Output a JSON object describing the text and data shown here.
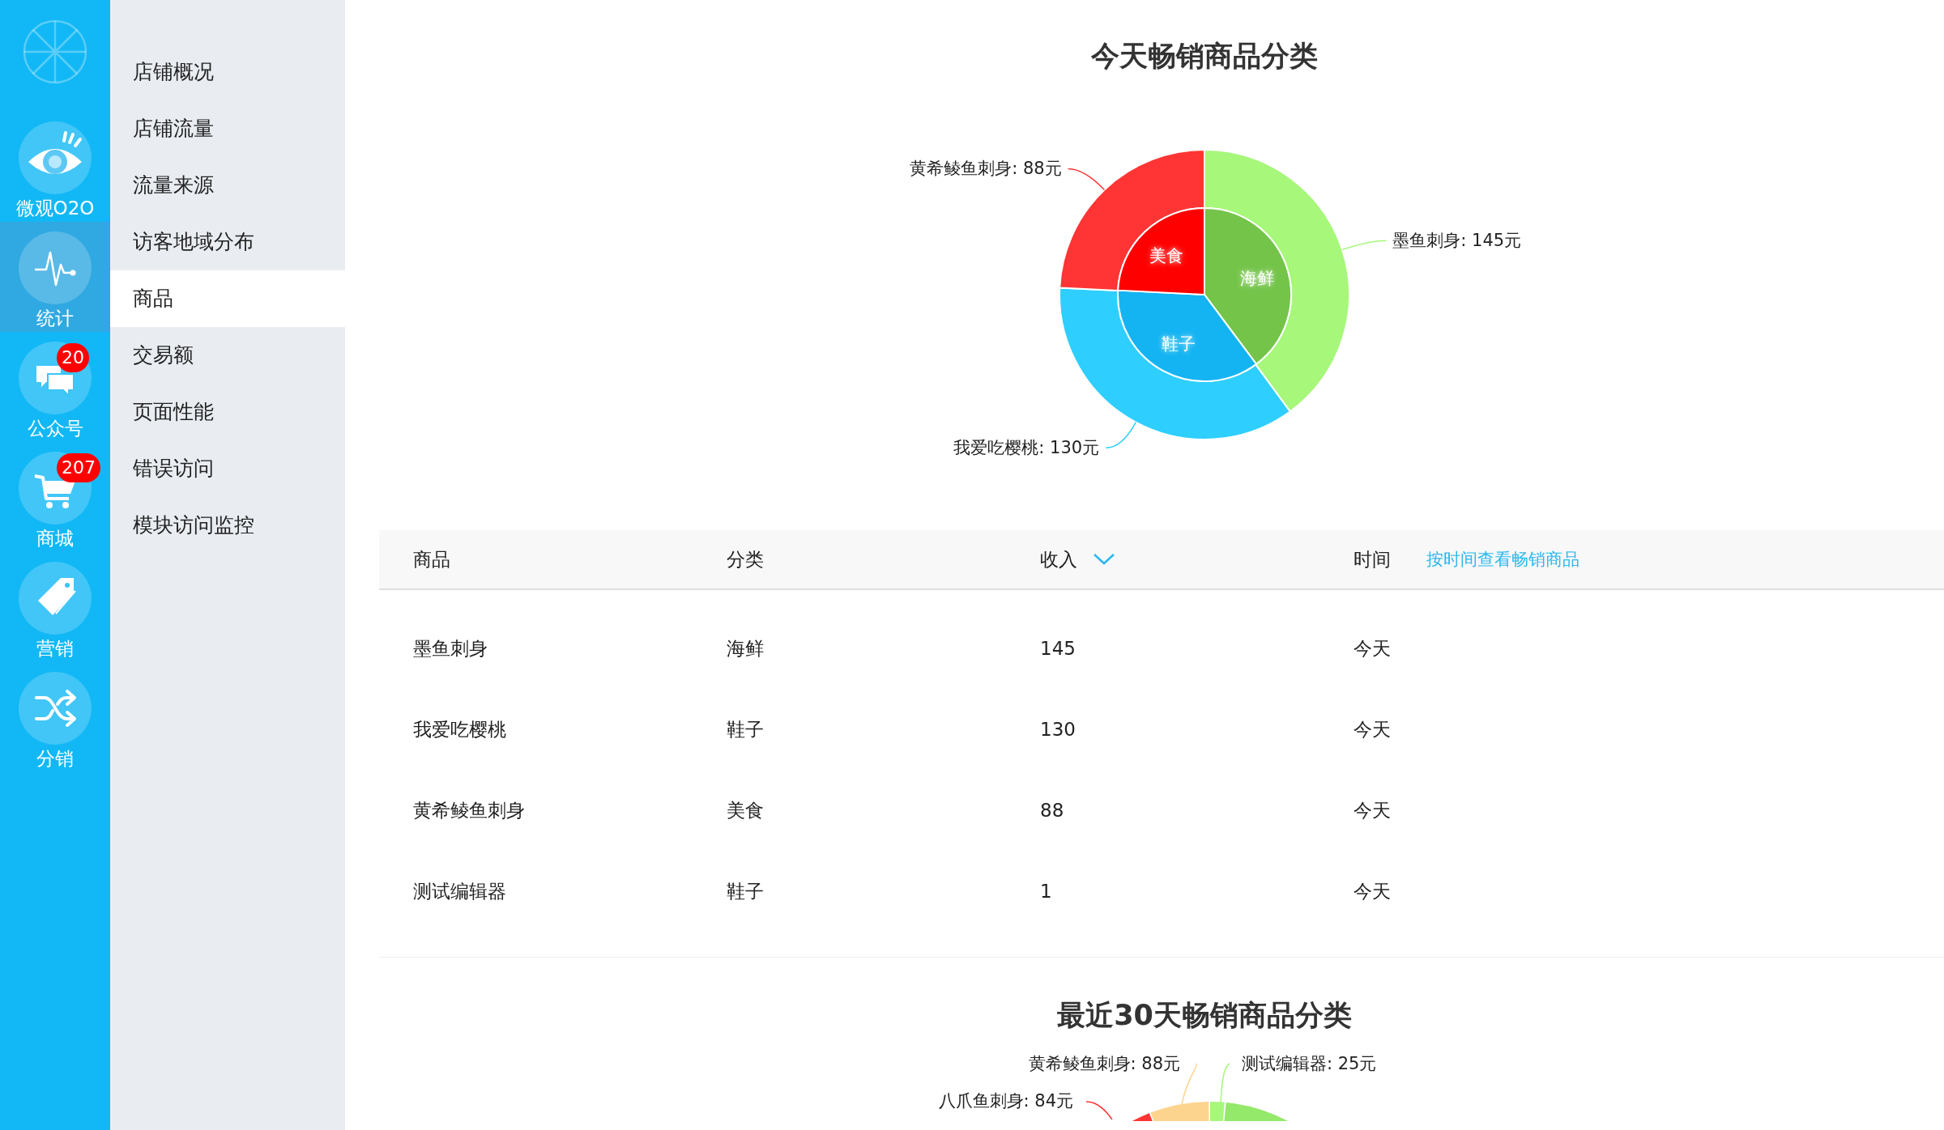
{
  "rail": {
    "items": [
      {
        "kind": "eye",
        "label": "微观O2O",
        "selected": false
      },
      {
        "kind": "pulse",
        "label": "统计",
        "selected": true
      },
      {
        "kind": "chat",
        "label": "公众号",
        "badge": "20",
        "selected": false
      },
      {
        "kind": "cart",
        "label": "商城",
        "badge": "207",
        "selected": false
      },
      {
        "kind": "tag",
        "label": "营销",
        "selected": false
      },
      {
        "kind": "shuffle",
        "label": "分销",
        "selected": false
      }
    ]
  },
  "submenu": {
    "items": [
      {
        "label": "店铺概况",
        "selected": false
      },
      {
        "label": "店铺流量",
        "selected": false
      },
      {
        "label": "流量来源",
        "selected": false
      },
      {
        "label": "访客地域分布",
        "selected": false
      },
      {
        "label": "商品",
        "selected": true
      },
      {
        "label": "交易额",
        "selected": false
      },
      {
        "label": "页面性能",
        "selected": false
      },
      {
        "label": "错误访问",
        "selected": false
      },
      {
        "label": "模块访问监控",
        "selected": false
      }
    ]
  },
  "today_chart": {
    "title": "今天畅销商品分类",
    "inner_ring": {
      "chart_data": {
        "type": "pie",
        "categories": [
          "海鲜",
          "鞋子",
          "美食"
        ],
        "values": [
          39.8,
          36.0,
          24.2
        ],
        "colors": [
          "#74c44a",
          "#14b4f2",
          "#ff0000"
        ]
      }
    },
    "outer_ring": {
      "chart_data": {
        "type": "donut",
        "categories": [
          "墨鱼刺身: 145元",
          "我爱吃樱桃: 130元",
          "黄希鲮鱼刺身: 88元"
        ],
        "values": [
          145,
          130,
          88
        ],
        "colors": [
          "#a6f77a",
          "#2ecfff",
          "#ff3434"
        ]
      }
    }
  },
  "table": {
    "columns": [
      {
        "label": "商品"
      },
      {
        "label": "分类"
      },
      {
        "label": "收入",
        "sorted": true
      },
      {
        "label": "时间"
      }
    ],
    "link": "按时间查看畅销商品",
    "rows": [
      [
        "墨鱼刺身",
        "海鲜",
        "145",
        "今天"
      ],
      [
        "我爱吃樱桃",
        "鞋子",
        "130",
        "今天"
      ],
      [
        "黄希鲮鱼刺身",
        "美食",
        "88",
        "今天"
      ],
      [
        "测试编辑器",
        "鞋子",
        "1",
        "今天"
      ]
    ]
  },
  "recent_chart": {
    "title": "最近30天畅销商品分类",
    "callouts": [
      {
        "text": "黄希鲮鱼刺身: 88元",
        "color": "#fdd48e"
      },
      {
        "text": "测试编辑器: 25元",
        "color": "#a6f77a"
      },
      {
        "text": "八爪鱼刺身: 84元",
        "color": "#ff3434"
      }
    ]
  }
}
